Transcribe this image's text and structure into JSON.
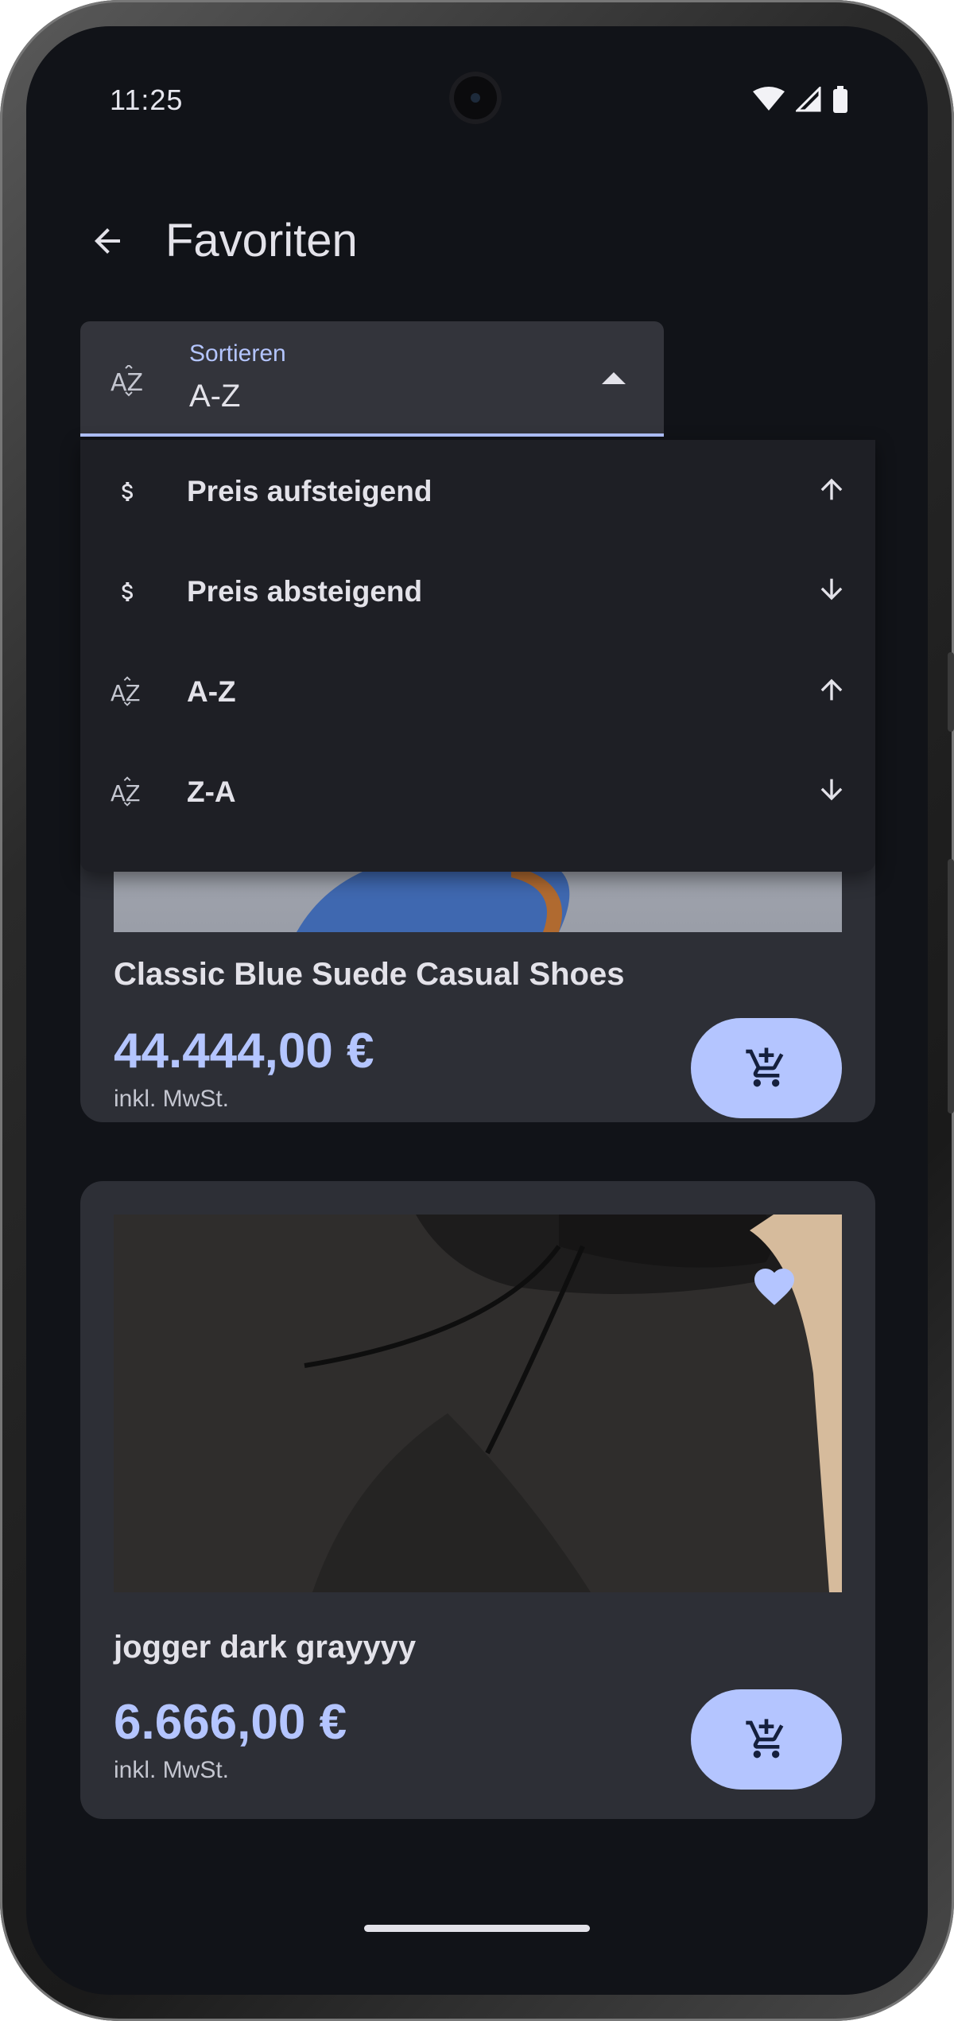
{
  "status_bar": {
    "time": "11:25"
  },
  "app_bar": {
    "title": "Favoriten"
  },
  "sort": {
    "label": "Sortieren",
    "value": "A-Z",
    "options": [
      {
        "label": "Preis aufsteigend",
        "icon": "dollar-icon",
        "direction": "up"
      },
      {
        "label": "Preis absteigend",
        "icon": "dollar-icon",
        "direction": "down"
      },
      {
        "label": "A-Z",
        "icon": "sort-az-icon",
        "direction": "up"
      },
      {
        "label": "Z-A",
        "icon": "sort-az-icon",
        "direction": "down"
      }
    ]
  },
  "products": [
    {
      "name": "Classic Blue Suede Casual Shoes",
      "price": "44.444,00 €",
      "tax": "inkl. MwSt."
    },
    {
      "name": "jogger dark grayyyy",
      "price": "6.666,00 €",
      "tax": "inkl. MwSt.",
      "favorite": true
    }
  ],
  "colors": {
    "accent": "#b4c5ff",
    "surface": "#2d2f36",
    "background": "#111318",
    "menu": "#1e1f25"
  }
}
